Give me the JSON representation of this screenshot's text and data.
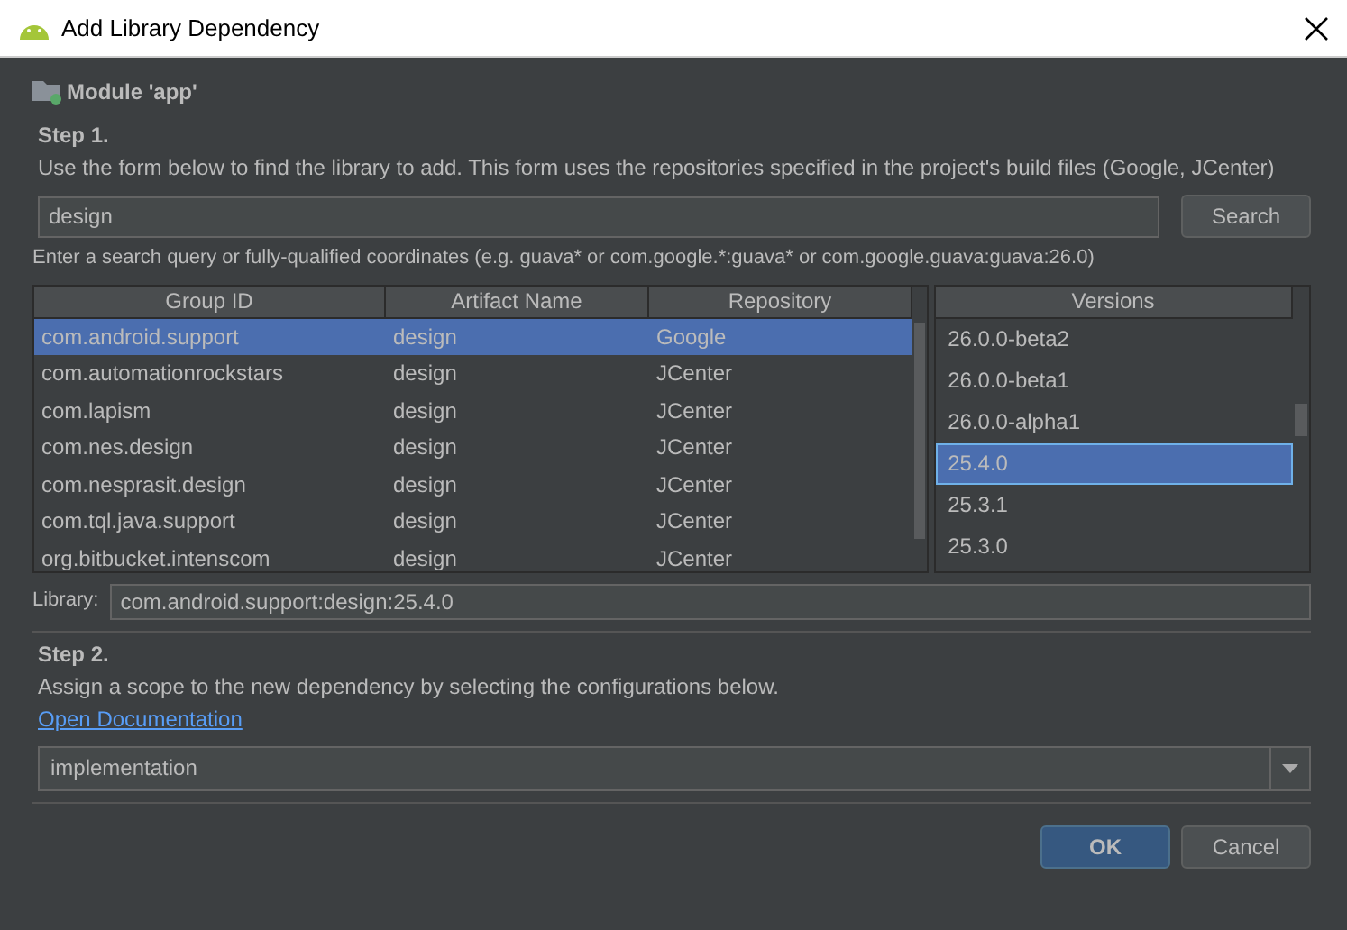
{
  "window": {
    "title": "Add Library Dependency"
  },
  "module": "Module 'app'",
  "step1": {
    "heading": "Step 1.",
    "description": "Use the form below to find the library to add. This form uses the repositories specified in the project's build files (Google, JCenter)"
  },
  "search": {
    "value": "design",
    "button": "Search",
    "hint": "Enter a search query or fully-qualified coordinates (e.g. guava* or com.google.*:guava* or com.google.guava:guava:26.0)"
  },
  "table": {
    "columns": [
      "Group ID",
      "Artifact Name",
      "Repository"
    ],
    "rows": [
      {
        "cells": [
          "com.android.support",
          "design",
          "Google"
        ],
        "selected": true
      },
      {
        "cells": [
          "com.automationrockstars",
          "design",
          "JCenter"
        ],
        "selected": false
      },
      {
        "cells": [
          "com.lapism",
          "design",
          "JCenter"
        ],
        "selected": false
      },
      {
        "cells": [
          "com.nes.design",
          "design",
          "JCenter"
        ],
        "selected": false
      },
      {
        "cells": [
          "com.nesprasit.design",
          "design",
          "JCenter"
        ],
        "selected": false
      },
      {
        "cells": [
          "com.tql.java.support",
          "design",
          "JCenter"
        ],
        "selected": false
      },
      {
        "cells": [
          "org.bitbucket.intenscom",
          "design",
          "JCenter"
        ],
        "selected": false
      }
    ]
  },
  "versions": {
    "heading": "Versions",
    "items": [
      {
        "label": "26.0.0-beta2",
        "selected": false
      },
      {
        "label": "26.0.0-beta1",
        "selected": false
      },
      {
        "label": "26.0.0-alpha1",
        "selected": false
      },
      {
        "label": "25.4.0",
        "selected": true
      },
      {
        "label": "25.3.1",
        "selected": false
      },
      {
        "label": "25.3.0",
        "selected": false
      }
    ]
  },
  "library": {
    "label": "Library:",
    "value": "com.android.support:design:25.4.0"
  },
  "step2": {
    "heading": "Step 2.",
    "description": "Assign a scope to the new dependency by selecting the configurations below.",
    "link": "Open Documentation"
  },
  "scope": {
    "value": "implementation"
  },
  "buttons": [
    {
      "label": "OK",
      "primary": true
    },
    {
      "label": "Cancel",
      "primary": false
    }
  ]
}
